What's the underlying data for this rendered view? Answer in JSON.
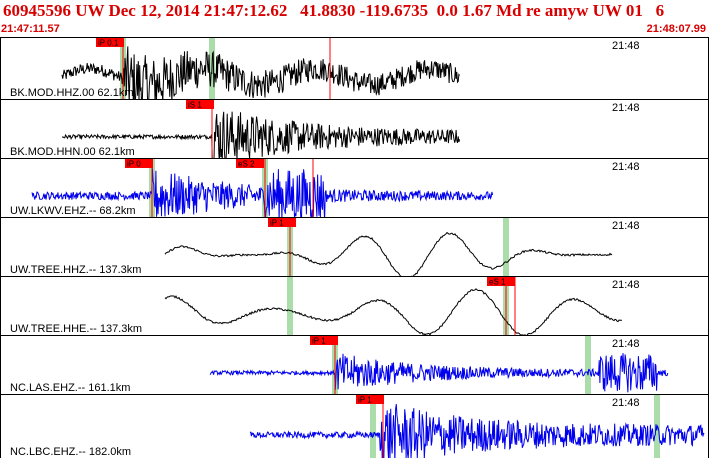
{
  "header": {
    "title": "60945596 UW Dec 12, 2014 21:47:12.62   41.8830 -119.6735  0.0 1.67 Md re amyw UW 01   6",
    "start_time": "21:47:11.57",
    "end_time": "21:48:07.99"
  },
  "colors": {
    "header_text": "#d80000",
    "pick_red": "#ff0000",
    "trace_black": "#000000",
    "trace_blue": "#0000ee",
    "pick_window_green": "#aaddaa"
  },
  "traces": [
    {
      "label": "BK.MOD.HHZ.00 62.1km",
      "time_mark": "21:48",
      "color": "black",
      "picks": [
        {
          "label": "iP 0.1",
          "kind": "P"
        }
      ]
    },
    {
      "label": "BK.MOD.HHN.00 62.1km",
      "time_mark": "21:48",
      "color": "black",
      "picks": [
        {
          "label": "iS 1",
          "kind": "S"
        }
      ]
    },
    {
      "label": "UW.LKWV.EHZ.-- 68.2km",
      "time_mark": "21:48",
      "color": "blue",
      "picks": [
        {
          "label": "iP 0",
          "kind": "P"
        },
        {
          "label": "eS 2",
          "kind": "S"
        }
      ]
    },
    {
      "label": "UW.TREE.HHZ.-- 137.3km",
      "time_mark": "21:48",
      "color": "black",
      "picks": [
        {
          "label": "iP 1",
          "kind": "P"
        }
      ]
    },
    {
      "label": "UW.TREE.HHE.-- 137.3km",
      "time_mark": "21:48",
      "color": "black",
      "picks": [
        {
          "label": "eS 1",
          "kind": "S"
        }
      ]
    },
    {
      "label": "NC.LAS.EHZ.-- 161.1km",
      "time_mark": "21:48",
      "color": "blue",
      "picks": [
        {
          "label": "iP 1",
          "kind": "P"
        }
      ]
    },
    {
      "label": "NC.LBC.EHZ.-- 182.0km",
      "time_mark": "21:48",
      "color": "blue",
      "picks": [
        {
          "label": "iP 1",
          "kind": "P"
        }
      ]
    }
  ]
}
